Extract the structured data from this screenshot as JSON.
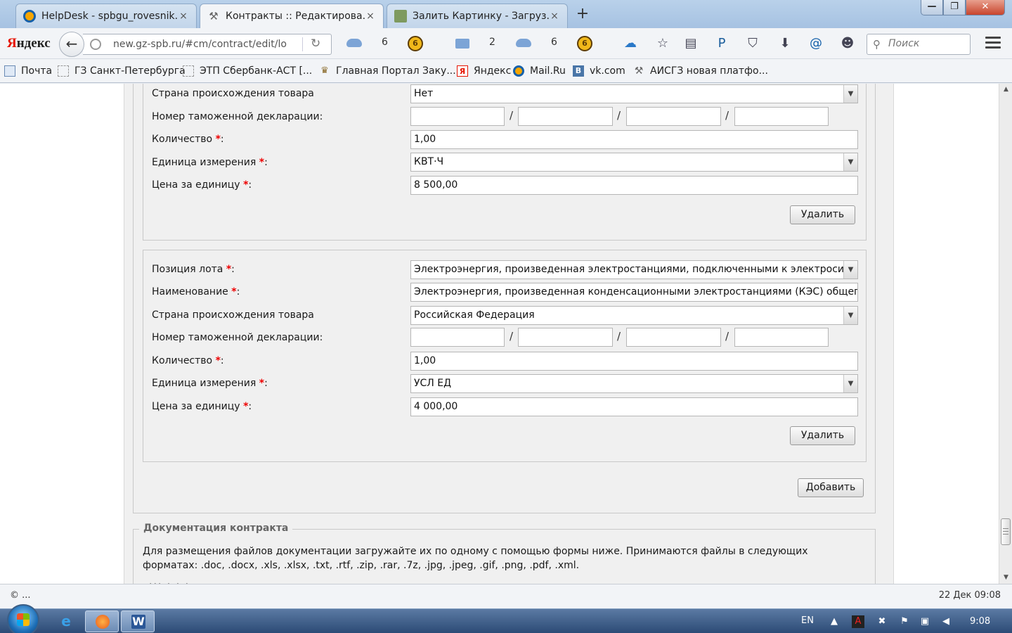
{
  "tabs": [
    {
      "title": "HelpDesk - spbgu_rovesnik...",
      "close": "×",
      "favicon": "mailru-icon"
    },
    {
      "title": "Контракты :: Редактирова...",
      "close": "×",
      "favicon": "tools-icon"
    },
    {
      "title": "Залить Картинку - Загруз...",
      "close": "×",
      "favicon": "image-icon"
    }
  ],
  "window_buttons": {
    "minimize": "—",
    "maximize": "❐",
    "close": "✕"
  },
  "new_tab": "+",
  "navbar": {
    "logo_prefix": "Я",
    "logo_rest": "ндекс",
    "back": "←",
    "reload": "↻",
    "url": "new.gz-spb.ru/#cm/contract/edit/lo",
    "counters": {
      "cloud_1": "6",
      "mail": "2",
      "cloud_2": "6",
      "coin": "6"
    },
    "search_placeholder": "Поиск"
  },
  "bookmarks": [
    {
      "label": "Почта",
      "icon": "envelope-icon"
    },
    {
      "label": "ГЗ Санкт-Петербурга",
      "icon": "page-icon"
    },
    {
      "label": "ЭТП Сбербанк-АСТ [...",
      "icon": "page-icon"
    },
    {
      "label": "Главная Портал Заку...",
      "icon": "eagle-icon"
    },
    {
      "label": "Яндекс",
      "icon": "yandex-icon"
    },
    {
      "label": "Mail.Ru",
      "icon": "mailru-icon"
    },
    {
      "label": "vk.com",
      "icon": "vk-icon"
    },
    {
      "label": "АИСГЗ новая платфо...",
      "icon": "tools-icon"
    }
  ],
  "form": {
    "item1": {
      "country_label": "Страна происхождения товара",
      "country_value": "Нет",
      "customs_label": "Номер таможенной декларации:",
      "quantity_label": "Количество",
      "quantity_value": "1,00",
      "unit_label": "Единица измерения",
      "unit_value": "КВТ·Ч",
      "price_label": "Цена за единицу",
      "price_value": "8 500,00",
      "delete_label": "Удалить"
    },
    "item2": {
      "position_label": "Позиция лота",
      "position_value": "Электроэнергия, произведенная электростанциями, подключенными к электросистеме |",
      "name_label": "Наименование",
      "name_value": "Электроэнергия, произведенная конденсационными электростанциями (КЭС) общего назна",
      "country_label": "Страна происхождения товара",
      "country_value": "Российская Федерация",
      "customs_label": "Номер таможенной декларации:",
      "quantity_label": "Количество",
      "quantity_value": "1,00",
      "unit_label": "Единица измерения",
      "unit_value": "УСЛ ЕД",
      "price_label": "Цена за единицу",
      "price_value": "4 000,00",
      "delete_label": "Удалить"
    },
    "required_mark": "*",
    "colon": ":",
    "slash": "/",
    "add_label": "Добавить"
  },
  "docs": {
    "legend": "Документация контракта",
    "text": "Для размещения файлов документации загружайте их по одному с помощью формы ниже. Принимаются файлы в следующих форматах: .doc, .docx, .xls, .xlsx, .txt, .rtf, .zip, .rar, .7z, .jpg, .jpeg, .gif, .png, .pdf, .xml.",
    "cut_text": "...  .  .  ."
  },
  "status": {
    "left": "© ...",
    "right": "22 Дек 09:08"
  },
  "taskbar": {
    "lang": "EN",
    "clock": "9:08"
  }
}
